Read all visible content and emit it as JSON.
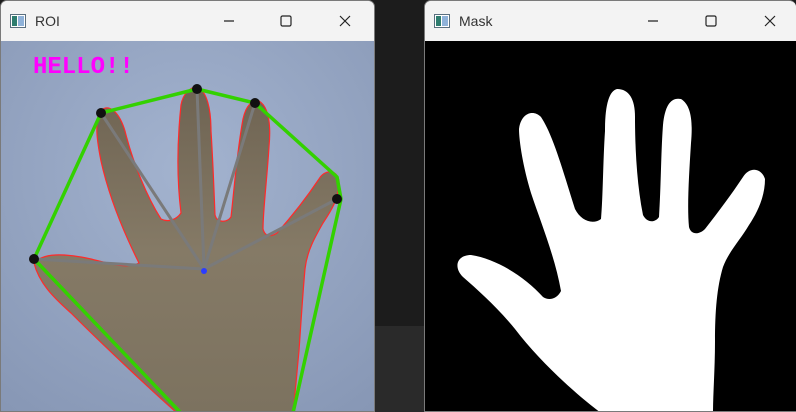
{
  "windows": [
    {
      "title": "ROI",
      "overlay_text": "HELLO!!",
      "overlay_color": "#ff00ff",
      "hull_color": "#33d100",
      "contour_color": "#ff2a2a"
    },
    {
      "title": "Mask"
    }
  ],
  "icons": [
    "app-icon",
    "minimize-icon",
    "maximize-icon",
    "close-icon"
  ],
  "colors": {
    "titlebar": "#f3f3f3",
    "roi_background": "#97a7c3",
    "hand": "#7f7461",
    "mask_background": "#000000",
    "mask_hand": "#ffffff"
  }
}
